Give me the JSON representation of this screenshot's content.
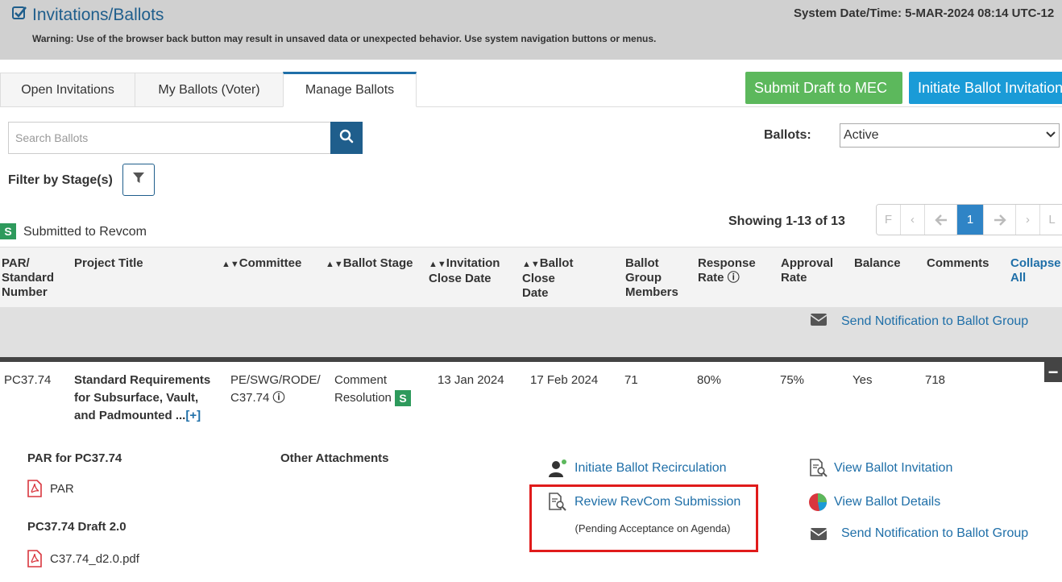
{
  "header": {
    "title": "Invitations/Ballots",
    "system_datetime": "System Date/Time: 5-MAR-2024   08:14 UTC-12",
    "warning": "Warning: Use of the browser back button may result in unsaved data or unexpected behavior. Use system navigation buttons or menus."
  },
  "tabs": [
    {
      "label": "Open Invitations"
    },
    {
      "label": "My Ballots (Voter)"
    },
    {
      "label": "Manage Ballots"
    }
  ],
  "buttons": {
    "submit_draft": "Submit Draft to MEC",
    "initiate_invitation": "Initiate Ballot Invitation"
  },
  "search": {
    "placeholder": "Search Ballots"
  },
  "ballots_filter": {
    "label": "Ballots:",
    "selected": "Active"
  },
  "filter_stage": {
    "label": "Filter by Stage(s)"
  },
  "legend": {
    "badge": "S",
    "text": "Submitted to Revcom"
  },
  "pagination": {
    "showing": "Showing 1-13 of 13",
    "first": "F",
    "prev": "‹",
    "prev_arrow": "🡐",
    "current": "1",
    "next_arrow": "🡒",
    "next": "›",
    "last": "L"
  },
  "table": {
    "headers": {
      "par": "PAR/ Standard Number",
      "project_title": "Project Title",
      "committee": "Committee",
      "ballot_stage": "Ballot Stage",
      "invitation_close": "Invitation Close Date",
      "ballot_close": "Ballot Close Date",
      "group_members": "Ballot Group Members",
      "response_rate": "Response Rate",
      "approval_rate": "Approval Rate",
      "balance": "Balance",
      "comments": "Comments",
      "collapse_all": "Collapse All"
    },
    "group_notification": "Send Notification to Ballot Group",
    "row": {
      "par": "PC37.74",
      "project_title": "Standard Requirements for Subsurface, Vault, and Padmounted ...",
      "expand": "[+]",
      "committee": "PE/SWG/RODE/C37.74",
      "ballot_stage": "Comment Resolution",
      "stage_badge": "S",
      "invitation_close": "13 Jan 2024",
      "ballot_close": "17 Feb 2024",
      "group_members": "71",
      "response_rate": "80%",
      "approval_rate": "75%",
      "balance": "Yes",
      "comments": "718"
    }
  },
  "details": {
    "par_heading": "PAR for PC37.74",
    "par_file": "PAR",
    "draft_heading": "PC37.74 Draft 2.0",
    "draft_file": "C37.74_d2.0.pdf",
    "other_attachments": "Other Attachments",
    "actions": {
      "recirculation": "Initiate Ballot Recirculation",
      "review_revcom": "Review RevCom Submission",
      "pending_note": "(Pending Acceptance on Agenda)",
      "view_invitation": "View Ballot Invitation",
      "view_details": "View Ballot Details",
      "send_notification": "Send Notification to Ballot Group"
    }
  },
  "colors": {
    "primary": "#1f5e8c",
    "green": "#5cb85c",
    "blue": "#1a9bd7",
    "badge": "#2e9a5c",
    "highlight": "#e01b1b"
  }
}
